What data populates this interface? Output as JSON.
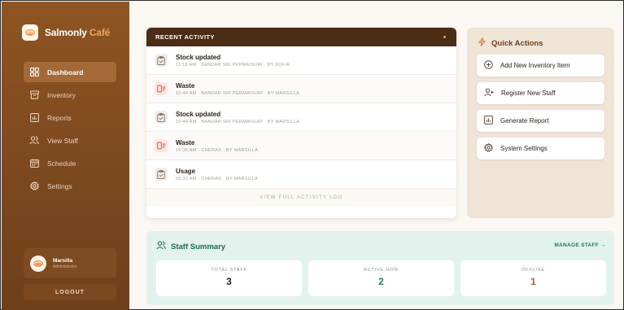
{
  "brand": {
    "name_main": "Salmonly",
    "name_accent": "Café"
  },
  "sidebar": {
    "items": [
      {
        "label": "Dashboard",
        "icon": "grid-icon"
      },
      {
        "label": "Inventory",
        "icon": "box-icon"
      },
      {
        "label": "Reports",
        "icon": "chart-icon"
      },
      {
        "label": "View Staff",
        "icon": "people-icon"
      },
      {
        "label": "Schedule",
        "icon": "calendar-icon"
      },
      {
        "label": "Settings",
        "icon": "gear-icon"
      }
    ],
    "user": {
      "name": "Marsilla",
      "role": "Administrator"
    },
    "logout_label": "LOGOUT"
  },
  "activity": {
    "title": "RECENT ACTIVITY",
    "rows": [
      {
        "type": "stock",
        "title": "Stock updated",
        "meta": "11:18 AM · BANDAR SRI PERMAISURI · BY SOFIA"
      },
      {
        "type": "waste",
        "title": "Waste",
        "meta": "10:44 AM · BANDAR SRI PERMAISURI · BY MARSILLA"
      },
      {
        "type": "stock",
        "title": "Stock updated",
        "meta": "10:44 AM · BANDAR SRI PERMAISURI · BY MARSILLA"
      },
      {
        "type": "waste",
        "title": "Waste",
        "meta": "10:36 AM · CHERAS · BY MARSILLA"
      },
      {
        "type": "stock",
        "title": "Usage",
        "meta": "09:32 AM · CHERAS · BY MARSILLA"
      }
    ],
    "view_all_label": "VIEW FULL ACTIVITY LOG"
  },
  "quick_actions": {
    "title": "Quick Actions",
    "items": [
      {
        "label": "Add New Inventory Item",
        "icon": "plus-circle-icon"
      },
      {
        "label": "Register New Staff",
        "icon": "user-plus-icon"
      },
      {
        "label": "Generate Report",
        "icon": "report-icon"
      },
      {
        "label": "System Settings",
        "icon": "gear-icon"
      }
    ]
  },
  "staff_summary": {
    "title": "Staff Summary",
    "manage_label": "MANAGE STAFF →",
    "stats": [
      {
        "label": "TOTAL STAFF",
        "value": "3",
        "color": "#2a1d14"
      },
      {
        "label": "ACTIVE NOW",
        "value": "2",
        "color": "#2f7a56"
      },
      {
        "label": "OFFLINE",
        "value": "1",
        "color": "#c0563a"
      }
    ]
  },
  "colors": {
    "sidebar": "#8e5423",
    "accent": "#f2a35d",
    "activity_header": "#4b2c14",
    "staff_bg": "#e1f3ec"
  }
}
